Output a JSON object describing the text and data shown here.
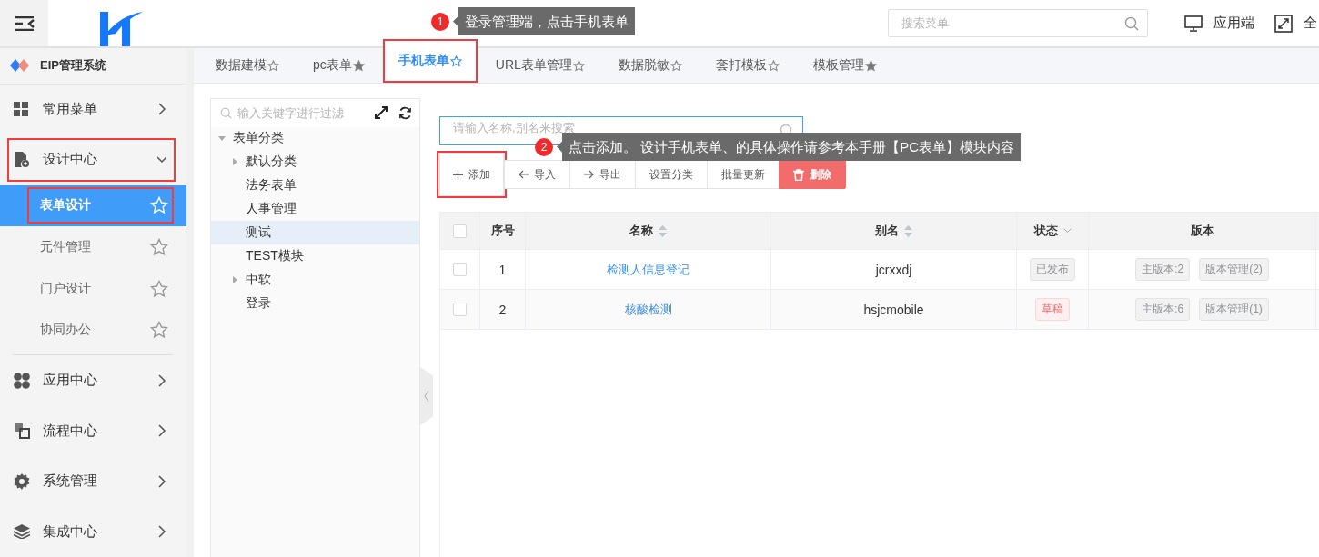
{
  "header": {
    "search": {
      "placeholder": "搜索菜单"
    },
    "app_link": "应用端",
    "fullscreen_link": "全"
  },
  "callouts": [
    {
      "number": "1",
      "text": "登录管理端，点击手机表单"
    },
    {
      "number": "2",
      "text": "点击添加。 设计手机表单、的具体操作请参考本手册【PC表单】模块内容"
    }
  ],
  "sidebar": {
    "brand": "EIP管理系统",
    "items": [
      {
        "label": "常用菜单",
        "expanded": false,
        "highlighted": false
      },
      {
        "label": "设计中心",
        "expanded": true,
        "highlighted": true,
        "children": [
          {
            "label": "表单设计",
            "selected": true,
            "highlighted": true
          },
          {
            "label": "元件管理",
            "selected": false,
            "highlighted": false
          },
          {
            "label": "门户设计",
            "selected": false,
            "highlighted": false
          },
          {
            "label": "协同办公",
            "selected": false,
            "highlighted": false
          }
        ]
      },
      {
        "label": "应用中心",
        "expanded": false,
        "highlighted": false
      },
      {
        "label": "流程中心",
        "expanded": false,
        "highlighted": false
      },
      {
        "label": "系统管理",
        "expanded": false,
        "highlighted": false
      },
      {
        "label": "集成中心",
        "expanded": false,
        "highlighted": false
      }
    ]
  },
  "tabs": [
    {
      "label": "数据建模",
      "starred": false,
      "selected": false,
      "highlighted": false
    },
    {
      "label": "pc表单",
      "starred": true,
      "selected": false,
      "highlighted": false
    },
    {
      "label": "手机表单",
      "starred": false,
      "selected": true,
      "highlighted": true
    },
    {
      "label": "URL表单管理",
      "starred": false,
      "selected": false,
      "highlighted": false
    },
    {
      "label": "数据脱敏",
      "starred": false,
      "selected": false,
      "highlighted": false
    },
    {
      "label": "套打模板",
      "starred": false,
      "selected": false,
      "highlighted": false
    },
    {
      "label": "模板管理",
      "starred": true,
      "selected": false,
      "highlighted": false
    }
  ],
  "tree": {
    "filter": {
      "placeholder": "输入关键字进行过滤"
    },
    "nodes": [
      {
        "label": "表单分类",
        "kind": "group",
        "expanded": true,
        "selected": false,
        "children": [
          {
            "label": "默认分类",
            "kind": "group",
            "expanded": false,
            "selected": false
          },
          {
            "label": "法务表单",
            "kind": "item",
            "selected": false
          },
          {
            "label": "人事管理",
            "kind": "item",
            "selected": false
          },
          {
            "label": "测试",
            "kind": "item",
            "selected": true
          },
          {
            "label": "TEST模块",
            "kind": "item",
            "selected": false
          },
          {
            "label": "中软",
            "kind": "group",
            "expanded": false,
            "selected": false
          },
          {
            "label": "登录",
            "kind": "item",
            "selected": false
          }
        ]
      }
    ]
  },
  "search": {
    "placeholder": "请输入名称,别名来搜索"
  },
  "toolbar": [
    {
      "label": "添加",
      "kind": "add",
      "highlighted": true
    },
    {
      "label": "导入",
      "kind": "import",
      "highlighted": false
    },
    {
      "label": "导出",
      "kind": "export",
      "highlighted": false
    },
    {
      "label": "设置分类",
      "kind": "plain",
      "highlighted": false
    },
    {
      "label": "批量更新",
      "kind": "plain",
      "highlighted": false
    },
    {
      "label": "删除",
      "kind": "danger",
      "highlighted": false
    }
  ],
  "table": {
    "all_checked": false,
    "columns": [
      {
        "kind": "checkbox"
      },
      {
        "label": "序号",
        "kind": "plain"
      },
      {
        "label": "名称",
        "kind": "sort"
      },
      {
        "label": "别名",
        "kind": "sort"
      },
      {
        "label": "状态",
        "kind": "filter"
      },
      {
        "label": "版本",
        "kind": "plain"
      }
    ],
    "rows": [
      {
        "checked": false,
        "index": "1",
        "name": "检测人信息登记",
        "alias": "jcrxxdj",
        "status": {
          "label": "已发布",
          "kind": "published"
        },
        "version": "主版本:2",
        "version_manage": "版本管理(2)"
      },
      {
        "checked": false,
        "index": "2",
        "name": "核酸检测",
        "alias": "hsjcmobile",
        "status": {
          "label": "草稿",
          "kind": "draft"
        },
        "version": "主版本:6",
        "version_manage": "版本管理(1)"
      }
    ]
  }
}
